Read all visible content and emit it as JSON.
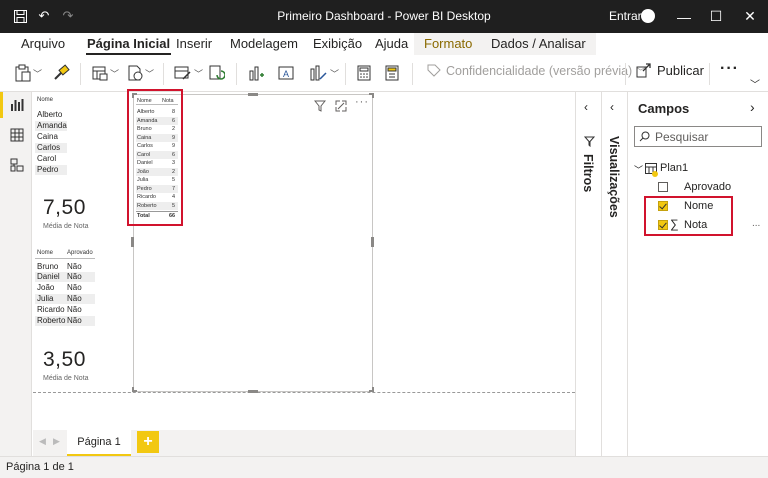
{
  "window": {
    "title": "Primeiro Dashboard - Power BI Desktop",
    "sign_in": "Entrar"
  },
  "ribbon_tabs": [
    "Arquivo",
    "Página Inicial",
    "Inserir",
    "Modelagem",
    "Exibição",
    "Ajuda",
    "Formato",
    "Dados / Analisar"
  ],
  "toolbar": {
    "sensitivity_label": "Confidencialidade (versão prévia)",
    "publish_label": "Publicar",
    "more_label": "···"
  },
  "canvas": {
    "slicer1": {
      "title": "Nome",
      "items": [
        "Alberto",
        "Amanda",
        "Caina",
        "Carlos",
        "Carol",
        "Pedro"
      ]
    },
    "card1": {
      "value": "7,50",
      "label": "Média de Nota"
    },
    "table_aprovado": {
      "headers": [
        "Nome",
        "Aprovado"
      ],
      "rows": [
        [
          "Bruno",
          "Não"
        ],
        [
          "Daniel",
          "Não"
        ],
        [
          "João",
          "Não"
        ],
        [
          "Julia",
          "Não"
        ],
        [
          "Ricardo",
          "Não"
        ],
        [
          "Roberto",
          "Não"
        ]
      ]
    },
    "card2": {
      "value": "3,50",
      "label": "Média de Nota"
    },
    "table_nota": {
      "headers": [
        "Nome",
        "Nota"
      ],
      "rows": [
        [
          "Alberto",
          "8"
        ],
        [
          "Amanda",
          "6"
        ],
        [
          "Bruno",
          "2"
        ],
        [
          "Caina",
          "9"
        ],
        [
          "Carlos",
          "9"
        ],
        [
          "Carol",
          "6"
        ],
        [
          "Daniel",
          "3"
        ],
        [
          "João",
          "2"
        ],
        [
          "Julia",
          "5"
        ],
        [
          "Pedro",
          "7"
        ],
        [
          "Ricardo",
          "4"
        ],
        [
          "Roberto",
          "5"
        ]
      ],
      "total_label": "Total",
      "total_value": "66"
    }
  },
  "pages": {
    "tab_label": "Página 1",
    "add_label": "+",
    "status": "Página 1 de 1"
  },
  "panes": {
    "filters_label": "Filtros",
    "visualizations_label": "Visualizações",
    "fields": {
      "title": "Campos",
      "search_placeholder": "Pesquisar",
      "table_name": "Plan1",
      "items": [
        {
          "label": "Aprovado",
          "checked": false
        },
        {
          "label": "Nome",
          "checked": true
        },
        {
          "label": "Nota",
          "checked": true
        }
      ],
      "more": "..."
    }
  },
  "colors": {
    "accent": "#f2c811",
    "highlight": "#d1132d",
    "titlebar": "#1f1f1f"
  }
}
